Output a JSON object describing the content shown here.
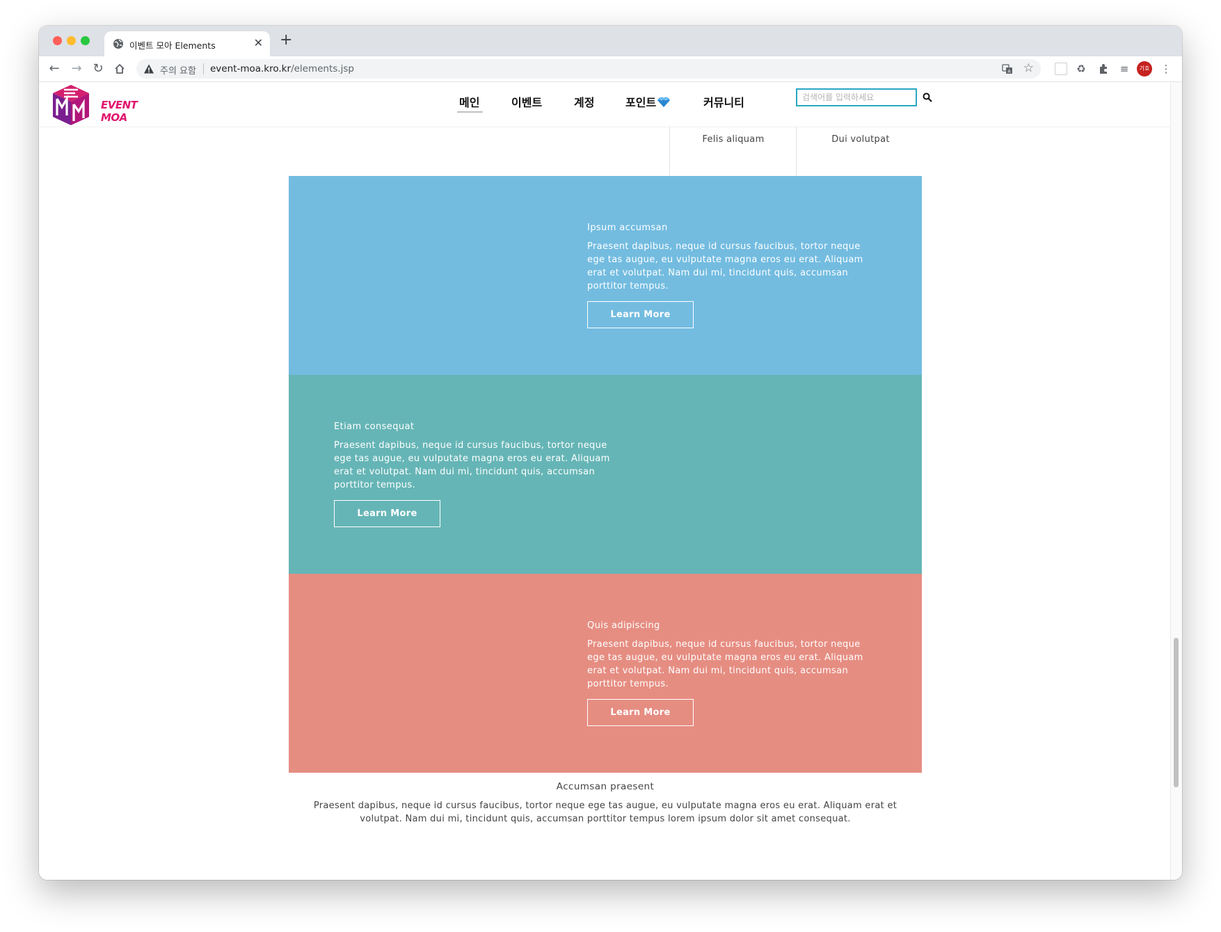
{
  "browser": {
    "tab_title": "이벤트 모아 Elements",
    "security_label": "주의 요함",
    "url_host": "event-moa.kro.kr",
    "url_path": "/elements.jsp",
    "avatar_label": "기호"
  },
  "site": {
    "logo_text": "EVENT MOA",
    "nav": [
      "메인",
      "이벤트",
      "계정",
      "포인트",
      "커뮤니티"
    ],
    "search_placeholder": "검색어를 입력하세요",
    "colors": {
      "accent": "#e2136e",
      "search_border": "#2aa7c3"
    }
  },
  "table_remnant": {
    "cells": [
      "Felis aliquam",
      "Dui volutpat"
    ]
  },
  "spotlights": [
    {
      "heading": "Ipsum accumsan",
      "text": "Praesent dapibus, neque id cursus faucibus, tortor neque ege tas augue, eu vulputate magna eros eu erat. Aliquam erat et volutpat. Nam dui mi, tincidunt quis, accumsan porttitor tempus.",
      "button": "Learn More",
      "color": "#73bce0"
    },
    {
      "heading": "Etiam consequat",
      "text": "Praesent dapibus, neque id cursus faucibus, tortor neque ege tas augue, eu vulputate magna eros eu erat. Aliquam erat et volutpat. Nam dui mi, tincidunt quis, accumsan porttitor tempus.",
      "button": "Learn More",
      "color": "#66b5b6"
    },
    {
      "heading": "Quis adipiscing",
      "text": "Praesent dapibus, neque id cursus faucibus, tortor neque ege tas augue, eu vulputate magna eros eu erat. Aliquam erat et volutpat. Nam dui mi, tincidunt quis, accumsan porttitor tempus.",
      "button": "Learn More",
      "color": "#e68d82"
    }
  ],
  "bottom": {
    "heading": "Accumsan praesent",
    "text": "Praesent dapibus, neque id cursus faucibus, tortor neque ege tas augue, eu vulputate magna eros eu erat. Aliquam erat et volutpat. Nam dui mi, tincidunt quis, accumsan porttitor tempus lorem ipsum dolor sit amet consequat."
  }
}
